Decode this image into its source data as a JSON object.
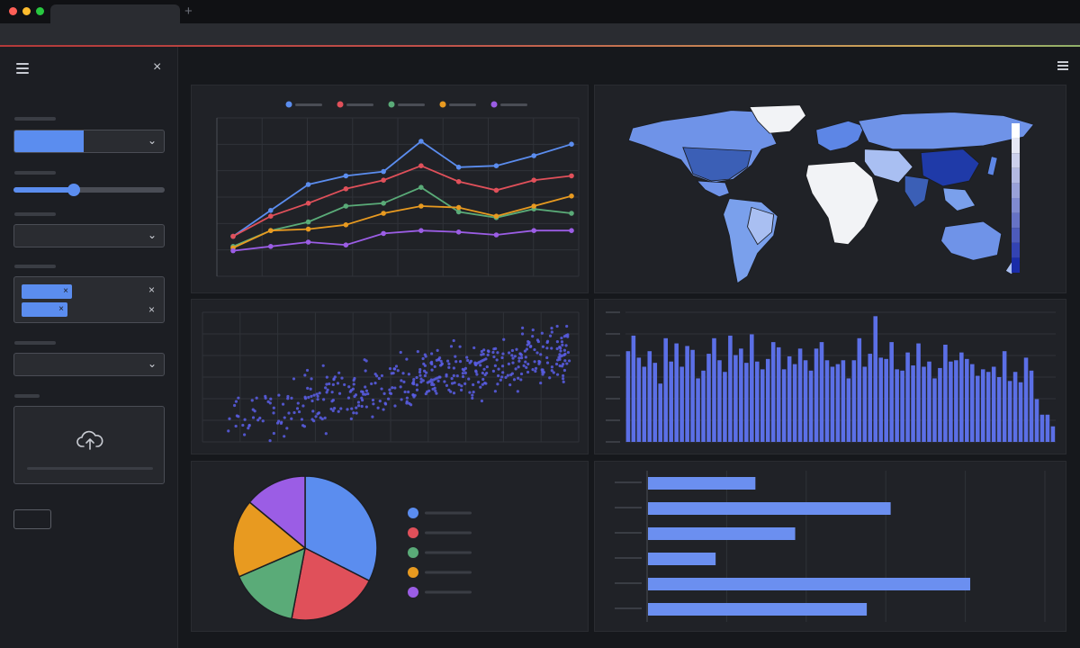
{
  "colors": {
    "accent": "#5b8def",
    "series": [
      "#5b8def",
      "#e0505a",
      "#5aab78",
      "#e89a20",
      "#9b5de5"
    ],
    "background": "#16181c",
    "panel": "#202227"
  },
  "icons": {
    "window_controls": [
      "close-dot",
      "minimize-dot",
      "maximize-dot"
    ],
    "sidebar_menu": "hamburger-icon",
    "sidebar_close": "close-icon",
    "upload": "cloud-upload-icon",
    "main_menu": "hamburger-icon"
  },
  "glyphs": {
    "new_tab": "+",
    "close": "×",
    "chevron": "⌄",
    "chip_remove": "×"
  },
  "sidebar": {
    "slider_value": 0.4,
    "first_select_fill": 0.46
  },
  "chart_data": [
    {
      "type": "line",
      "x": [
        1,
        2,
        3,
        4,
        5,
        6,
        7,
        8,
        9,
        10
      ],
      "series": [
        {
          "values": [
            24,
            42,
            60,
            66,
            69,
            90,
            72,
            73,
            80,
            88
          ]
        },
        {
          "values": [
            24,
            38,
            47,
            57,
            63,
            73,
            62,
            56,
            63,
            66
          ]
        },
        {
          "values": [
            17,
            28,
            34,
            45,
            47,
            58,
            41,
            37,
            43,
            40
          ]
        },
        {
          "values": [
            16,
            28,
            29,
            32,
            40,
            45,
            44,
            38,
            45,
            52
          ]
        },
        {
          "values": [
            14,
            17,
            20,
            18,
            26,
            28,
            27,
            25,
            28,
            28
          ]
        }
      ],
      "grid": true,
      "legend": "top"
    },
    {
      "type": "heatmap",
      "subtype": "choropleth-world-map",
      "color_scale": [
        "#ffffff",
        "#1a2ca8"
      ],
      "grid": false,
      "legend": "right"
    },
    {
      "type": "scatter",
      "x_range": [
        0,
        100
      ],
      "y_range": [
        0,
        100
      ],
      "trend": "positive",
      "points": 450,
      "grid": true
    },
    {
      "type": "bar",
      "orientation": "vertical",
      "values": [
        70,
        82,
        65,
        58,
        70,
        61,
        45,
        80,
        62,
        76,
        58,
        74,
        71,
        49,
        55,
        68,
        80,
        63,
        54,
        82,
        67,
        72,
        61,
        83,
        62,
        56,
        64,
        77,
        73,
        56,
        66,
        60,
        72,
        63,
        55,
        72,
        77,
        63,
        58,
        60,
        63,
        49,
        63,
        80,
        58,
        68,
        97,
        65,
        64,
        77,
        56,
        55,
        69,
        59,
        76,
        58,
        62,
        49,
        57,
        75,
        62,
        63,
        69,
        64,
        60,
        51,
        56,
        54,
        58,
        50,
        70,
        47,
        54,
        46,
        65,
        55,
        33,
        21,
        21,
        12
      ],
      "grid": true
    },
    {
      "type": "pie",
      "values": [
        32.5,
        20.5,
        15.5,
        17.5,
        14
      ],
      "legend": "right"
    },
    {
      "type": "bar",
      "orientation": "horizontal",
      "values": [
        27,
        61,
        37,
        17,
        81,
        55
      ],
      "xlim": [
        0,
        100
      ],
      "grid": true
    }
  ]
}
